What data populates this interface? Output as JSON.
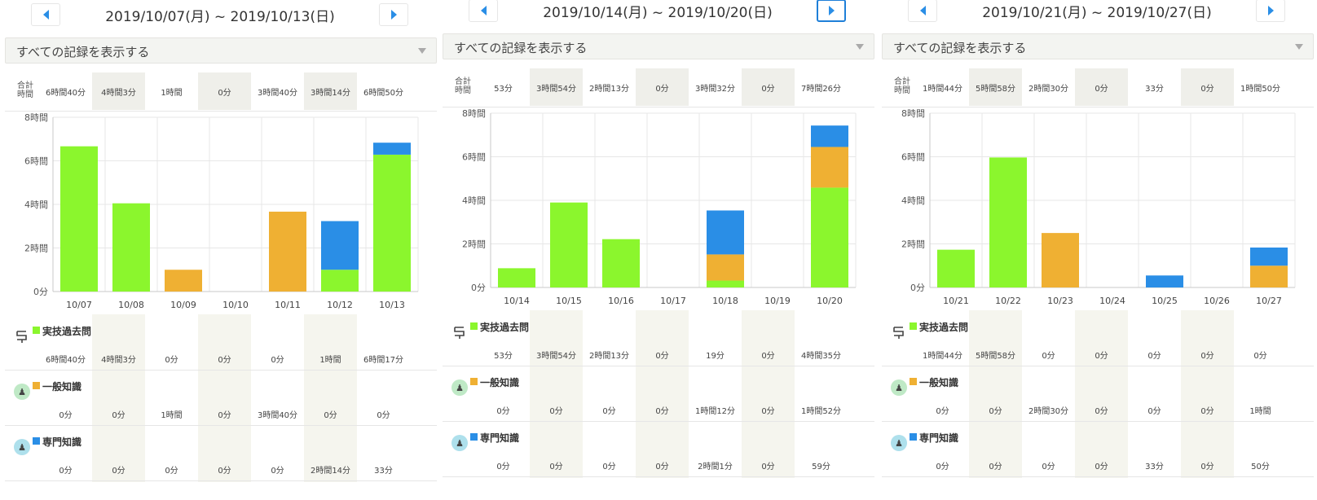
{
  "colors": {
    "practice": "#8bf62d",
    "general": "#efb033",
    "special": "#2a8ee6"
  },
  "filter_label": "すべての記録を表示する",
  "totals_label": "合計時間",
  "categories": [
    {
      "name": "実技過去問",
      "icon": "practice-icon"
    },
    {
      "name": "一般知識",
      "icon": "general-knowledge-icon"
    },
    {
      "name": "専門知識",
      "icon": "special-knowledge-icon"
    }
  ],
  "panels": [
    {
      "range": "2019/10/07(月) ~ 2019/10/13(日)",
      "totals": [
        "6時間40分",
        "4時間3分",
        "1時間",
        "0分",
        "3時間40分",
        "3時間14分",
        "6時間50分"
      ],
      "rows": [
        [
          "6時間40分",
          "4時間3分",
          "0分",
          "0分",
          "0分",
          "1時間",
          "6時間17分"
        ],
        [
          "0分",
          "0分",
          "1時間",
          "0分",
          "3時間40分",
          "0分",
          "0分"
        ],
        [
          "0分",
          "0分",
          "0分",
          "0分",
          "0分",
          "2時間14分",
          "33分"
        ]
      ]
    },
    {
      "range": "2019/10/14(月) ~ 2019/10/20(日)",
      "totals": [
        "53分",
        "3時間54分",
        "2時間13分",
        "0分",
        "3時間32分",
        "0分",
        "7時間26分"
      ],
      "rows": [
        [
          "53分",
          "3時間54分",
          "2時間13分",
          "0分",
          "19分",
          "0分",
          "4時間35分"
        ],
        [
          "0分",
          "0分",
          "0分",
          "0分",
          "1時間12分",
          "0分",
          "1時間52分"
        ],
        [
          "0分",
          "0分",
          "0分",
          "0分",
          "2時間1分",
          "0分",
          "59分"
        ]
      ]
    },
    {
      "range": "2019/10/21(月) ~ 2019/10/27(日)",
      "totals": [
        "1時間44分",
        "5時間58分",
        "2時間30分",
        "0分",
        "33分",
        "0分",
        "1時間50分"
      ],
      "rows": [
        [
          "1時間44分",
          "5時間58分",
          "0分",
          "0分",
          "0分",
          "0分",
          "0分"
        ],
        [
          "0分",
          "0分",
          "2時間30分",
          "0分",
          "0分",
          "0分",
          "1時間"
        ],
        [
          "0分",
          "0分",
          "0分",
          "0分",
          "33分",
          "0分",
          "50分"
        ]
      ]
    }
  ],
  "chart_data": [
    {
      "type": "bar",
      "stacked": true,
      "categories": [
        "10/07",
        "10/08",
        "10/09",
        "10/10",
        "10/11",
        "10/12",
        "10/13"
      ],
      "y_ticks": [
        "0分",
        "2時間",
        "4時間",
        "6時間",
        "8時間"
      ],
      "ylim": [
        0,
        8
      ],
      "series": [
        {
          "name": "実技過去問",
          "values": [
            6.667,
            4.05,
            0,
            0,
            0,
            1.0,
            6.283
          ]
        },
        {
          "name": "一般知識",
          "values": [
            0,
            0,
            1.0,
            0,
            3.667,
            0,
            0
          ]
        },
        {
          "name": "専門知識",
          "values": [
            0,
            0,
            0,
            0,
            0,
            2.233,
            0.55
          ]
        }
      ]
    },
    {
      "type": "bar",
      "stacked": true,
      "categories": [
        "10/14",
        "10/15",
        "10/16",
        "10/17",
        "10/18",
        "10/19",
        "10/20"
      ],
      "y_ticks": [
        "0分",
        "2時間",
        "4時間",
        "6時間",
        "8時間"
      ],
      "ylim": [
        0,
        8
      ],
      "series": [
        {
          "name": "実技過去問",
          "values": [
            0.883,
            3.9,
            2.217,
            0,
            0.317,
            0,
            4.583
          ]
        },
        {
          "name": "一般知識",
          "values": [
            0,
            0,
            0,
            0,
            1.2,
            0,
            1.867
          ]
        },
        {
          "name": "専門知識",
          "values": [
            0,
            0,
            0,
            0,
            2.017,
            0,
            0.983
          ]
        }
      ]
    },
    {
      "type": "bar",
      "stacked": true,
      "categories": [
        "10/21",
        "10/22",
        "10/23",
        "10/24",
        "10/25",
        "10/26",
        "10/27"
      ],
      "y_ticks": [
        "0分",
        "2時間",
        "4時間",
        "6時間",
        "8時間"
      ],
      "ylim": [
        0,
        8
      ],
      "series": [
        {
          "name": "実技過去問",
          "values": [
            1.733,
            5.967,
            0,
            0,
            0,
            0,
            0
          ]
        },
        {
          "name": "一般知識",
          "values": [
            0,
            0,
            2.5,
            0,
            0,
            0,
            1.0
          ]
        },
        {
          "name": "専門知識",
          "values": [
            0,
            0,
            0,
            0,
            0.55,
            0,
            0.833
          ]
        }
      ]
    }
  ]
}
